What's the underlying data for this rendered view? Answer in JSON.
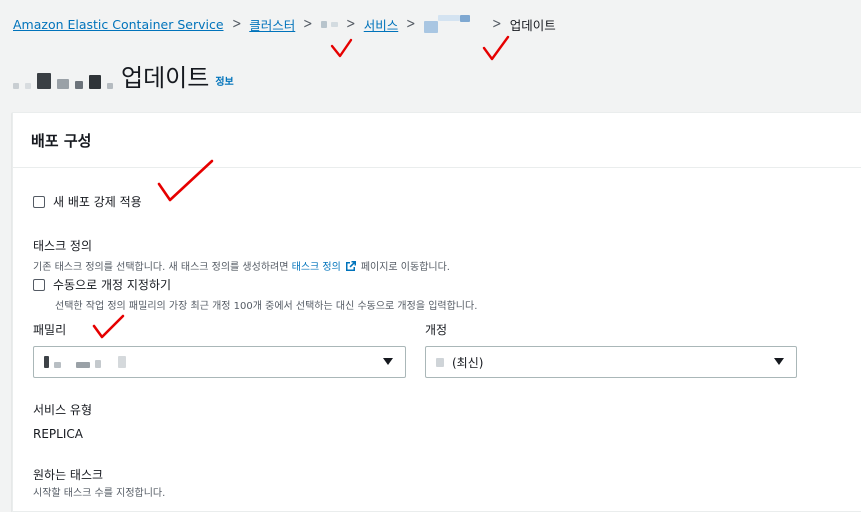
{
  "breadcrumb": {
    "root": "Amazon Elastic Container Service",
    "clusters": "클러스터",
    "services": "서비스",
    "current": "업데이트",
    "separator": ">"
  },
  "header": {
    "title": "업데이트",
    "info": "정보"
  },
  "panel": {
    "title": "배포 구성",
    "force_new_deployment": "새 배포 강제 적용",
    "task_definition": {
      "label": "태스크 정의",
      "desc_prefix": "기존 태스크 정의를 선택합니다. 새 태스크 정의를 생성하려면",
      "desc_link": "태스크 정의",
      "desc_suffix": "페이지로 이동합니다."
    },
    "manual_revision": {
      "label": "수동으로 개정 지정하기",
      "desc": "선택한 작업 정의 패밀리의 가장 최근 개정 100개 중에서 선택하는 대신 수동으로 개정을 입력합니다."
    },
    "family": {
      "label": "패밀리",
      "value": ""
    },
    "revision": {
      "label": "개정",
      "value": "(최신)"
    },
    "service_type": {
      "label": "서비스 유형",
      "value": "REPLICA"
    },
    "desired_tasks": {
      "label": "원하는 태스크",
      "desc": "시작할 태스크 수를 지정합니다."
    }
  },
  "colors": {
    "link": "#0073bb",
    "annotation": "#e60000",
    "page_bg": "#f2f3f3"
  },
  "icons": [
    "external-link-icon",
    "dropdown-caret-icon",
    "checkmark-annotation-icon"
  ]
}
